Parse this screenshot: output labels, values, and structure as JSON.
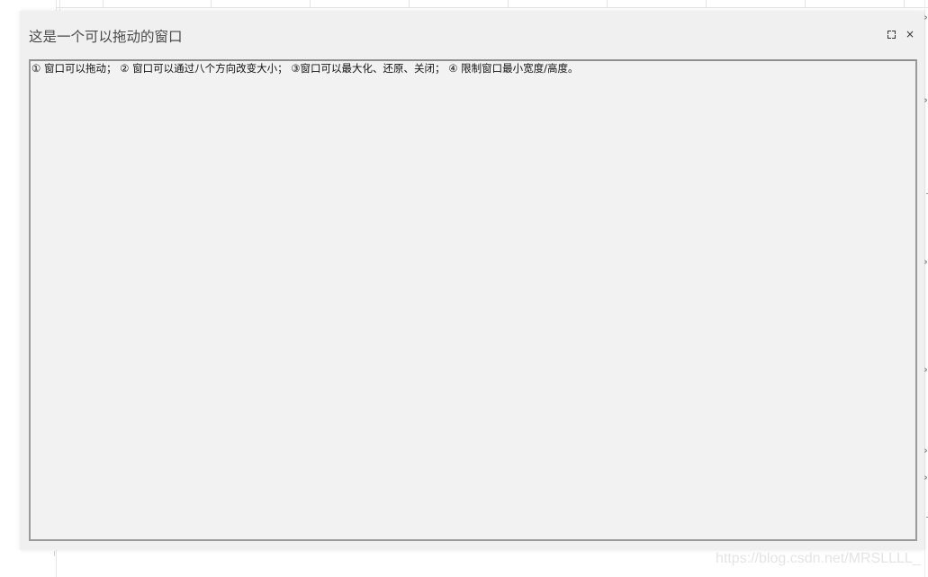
{
  "window": {
    "title": "这是一个可以拖动的窗口",
    "maximize_icon": "maximize-icon",
    "close_label": "×",
    "content": "① 窗口可以拖动； ② 窗口可以通过八个方向改变大小； ③窗口可以最大化、还原、关闭； ④ 限制窗口最小宽度/高度。"
  },
  "watermark": "https://blog.csdn.net/MRSLLLL_",
  "colors": {
    "window_bg": "#f0f0f0",
    "body_bg": "#f2f2f2",
    "border": "#9a9a9a",
    "title_text": "#4a4a4a"
  }
}
